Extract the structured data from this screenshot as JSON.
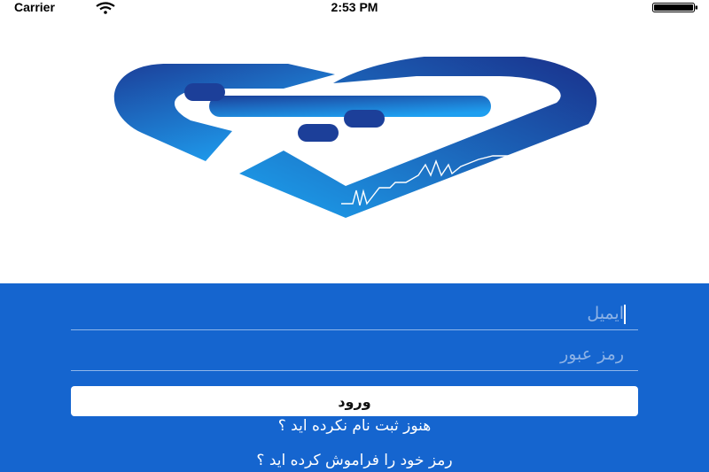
{
  "status_bar": {
    "carrier": "Carrier",
    "time": "2:53 PM",
    "wifi_icon": "wifi-icon",
    "battery_icon": "battery-icon"
  },
  "logo": {
    "icon": "heart-pulse-logo",
    "colors": {
      "dark": "#1c3f99",
      "light": "#1ea0ec"
    }
  },
  "login": {
    "background_color": "#1565cf",
    "email_placeholder": "ایمیل",
    "password_placeholder": "رمز عبور",
    "submit_label": "ورود",
    "register_link": "هنوز ثبت نام نکرده اید ؟",
    "forgot_link": "رمز خود را فراموش کرده اید ؟"
  }
}
